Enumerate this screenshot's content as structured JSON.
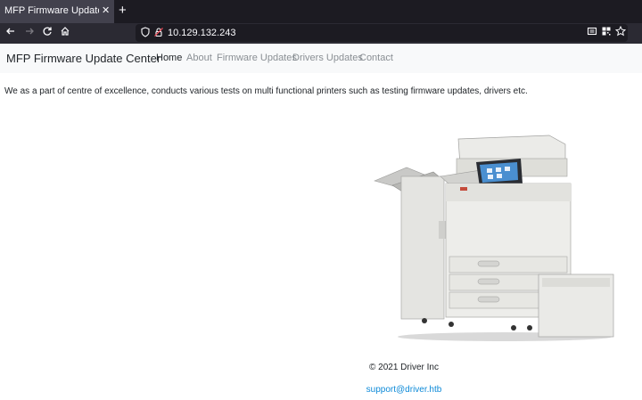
{
  "browser": {
    "tab_title": "MFP Firmware Update Center",
    "tab_close": "✕",
    "new_tab": "+",
    "url": "10.129.132.243"
  },
  "navbar": {
    "brand": "MFP Firmware Update Center",
    "links": [
      "Home",
      "About",
      "Firmware Updates",
      "Drivers Updates",
      "Contact"
    ]
  },
  "intro_text": "We as a part of centre of excellence, conducts various tests on multi functional printers such as testing firmware updates, drivers etc.",
  "footer": {
    "copyright": "© 2021 Driver Inc",
    "support_email": "support@driver.htb"
  },
  "colors": {
    "tabbar": "#1c1b22",
    "toolbar": "#2b2a33",
    "navbar_bg": "#f8f9fa",
    "link_color": "#0d8ad8"
  }
}
